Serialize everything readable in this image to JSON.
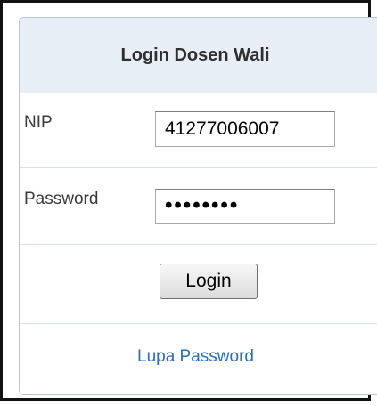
{
  "panel": {
    "title": "Login Dosen Wali"
  },
  "form": {
    "nip_label": "NIP",
    "nip_value": "41277006007",
    "password_label": "Password",
    "password_value": "••••••••",
    "login_label": "Login"
  },
  "links": {
    "forgot_password": "Lupa Password"
  }
}
